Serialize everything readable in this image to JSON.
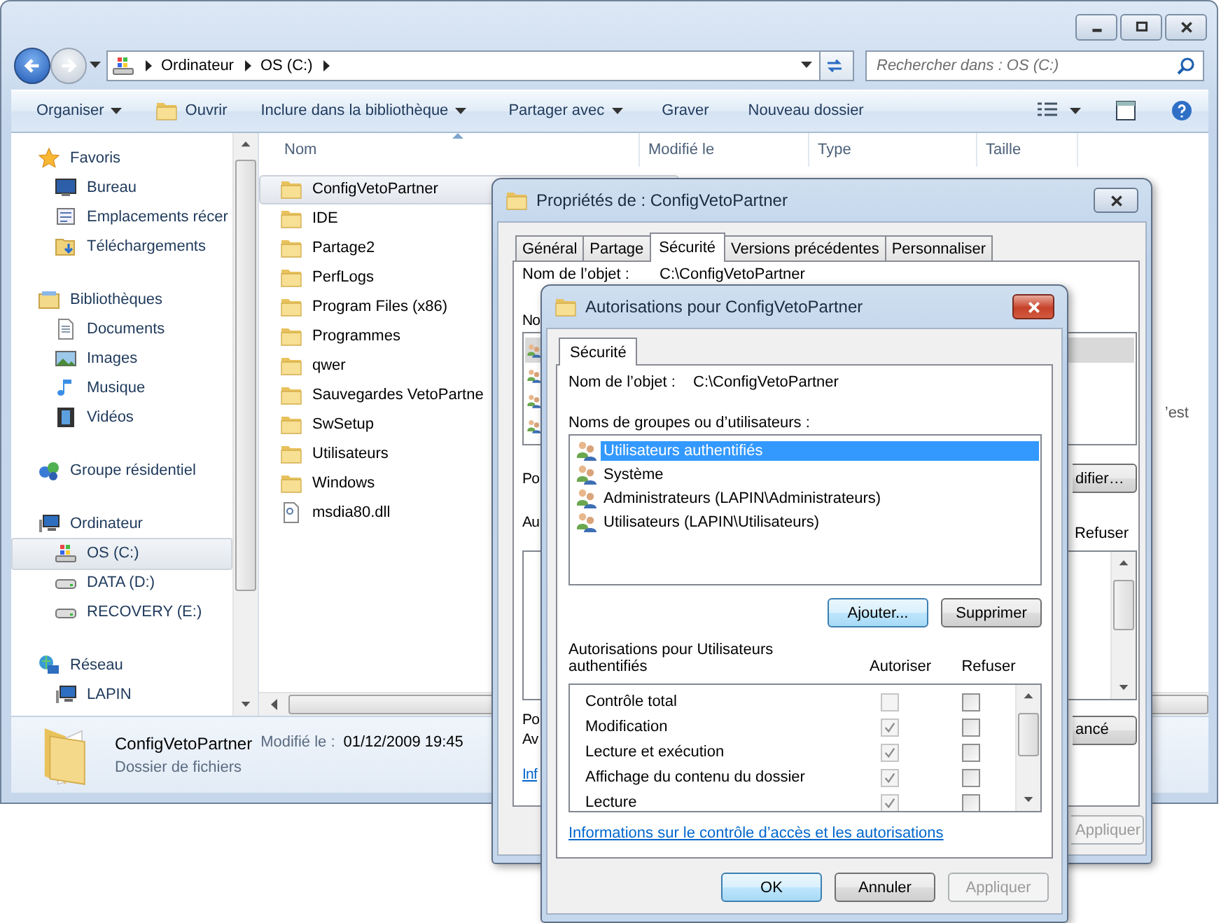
{
  "explorer": {
    "address": {
      "crumbs": [
        "Ordinateur",
        "OS (C:)"
      ]
    },
    "search": {
      "placeholder": "Rechercher dans : OS (C:)"
    },
    "toolbar": [
      {
        "label": "Organiser",
        "has_menu": true,
        "kind": "plain"
      },
      {
        "label": "Ouvrir",
        "has_menu": false,
        "kind": "with_icon"
      },
      {
        "label": "Inclure dans la bibliothèque",
        "has_menu": true,
        "kind": "plain"
      },
      {
        "label": "Partager avec",
        "has_menu": true,
        "kind": "plain"
      },
      {
        "label": "Graver",
        "has_menu": false,
        "kind": "plain"
      },
      {
        "label": "Nouveau dossier",
        "has_menu": false,
        "kind": "plain"
      }
    ],
    "sidebar": [
      {
        "label": "Favoris",
        "kind": "star",
        "children": [
          {
            "label": "Bureau",
            "kind": "desktop",
            "selected": false
          },
          {
            "label": "Emplacements récer",
            "kind": "recent",
            "selected": false
          },
          {
            "label": "Téléchargements",
            "kind": "downloads",
            "selected": false
          }
        ]
      },
      {
        "label": "Bibliothèques",
        "kind": "library",
        "children": [
          {
            "label": "Documents",
            "kind": "document",
            "selected": false
          },
          {
            "label": "Images",
            "kind": "image",
            "selected": false
          },
          {
            "label": "Musique",
            "kind": "music",
            "selected": false
          },
          {
            "label": "Vidéos",
            "kind": "video",
            "selected": false
          }
        ]
      },
      {
        "label": "Groupe résidentiel",
        "kind": "homegroup"
      },
      {
        "label": "Ordinateur",
        "kind": "computer",
        "children": [
          {
            "label": "OS (C:)",
            "kind": "osdrive",
            "selected": true
          },
          {
            "label": "DATA (D:)",
            "kind": "drive",
            "selected": false
          },
          {
            "label": "RECOVERY (E:)",
            "kind": "drive",
            "selected": false
          }
        ]
      },
      {
        "label": "Réseau",
        "kind": "network",
        "children": [
          {
            "label": "LAPIN",
            "kind": "computer",
            "selected": false
          }
        ]
      }
    ],
    "columns": [
      "Nom",
      "Modifié le",
      "Type",
      "Taille"
    ],
    "files": [
      {
        "name": "ConfigVetoPartner",
        "kind": "folder",
        "selected": true
      },
      {
        "name": "IDE",
        "kind": "folder",
        "selected": false
      },
      {
        "name": "Partage2",
        "kind": "folder",
        "selected": false
      },
      {
        "name": "PerfLogs",
        "kind": "folder",
        "selected": false
      },
      {
        "name": "Program Files (x86)",
        "kind": "folder",
        "selected": false
      },
      {
        "name": "Programmes",
        "kind": "folder",
        "selected": false
      },
      {
        "name": "qwer",
        "kind": "folder",
        "selected": false
      },
      {
        "name": "Sauvegardes VetoPartne",
        "kind": "folder",
        "selected": false
      },
      {
        "name": "SwSetup",
        "kind": "folder",
        "selected": false
      },
      {
        "name": "Utilisateurs",
        "kind": "folder",
        "selected": false
      },
      {
        "name": "Windows",
        "kind": "folder",
        "selected": false
      },
      {
        "name": "msdia80.dll",
        "kind": "file",
        "selected": false
      }
    ],
    "side_text": "’est",
    "details": {
      "name": "ConfigVetoPartner",
      "modified_label": "Modifié le :",
      "modified_value": "01/12/2009 19:45",
      "type": "Dossier de fichiers"
    }
  },
  "properties_dialog": {
    "title": "Propriétés de : ConfigVetoPartner",
    "tabs": [
      {
        "label": "Général",
        "selected": false
      },
      {
        "label": "Partage",
        "selected": false
      },
      {
        "label": "Sécurité",
        "selected": true
      },
      {
        "label": "Versions précédentes",
        "selected": false
      },
      {
        "label": "Personnaliser",
        "selected": false
      }
    ],
    "object_label": "Nom de l’objet :",
    "object_value": "C:\\ConfigVetoPartner",
    "groups_label": "No",
    "user_rows": [
      {
        "selected": true
      },
      {
        "selected": false
      },
      {
        "selected": false
      },
      {
        "selected": false
      }
    ],
    "edit_label": "Po",
    "edit_button": "difier…",
    "permissions_label": "Au",
    "deny_header": "Refuser",
    "advanced_label_1": "Po",
    "advanced_label_2": "Av",
    "advanced_button": "ancé",
    "info_link": "Inf",
    "apply_button": {
      "label": "Appliquer",
      "disabled": true
    }
  },
  "permissions_dialog": {
    "title": "Autorisations pour ConfigVetoPartner",
    "tab": "Sécurité",
    "object_label": "Nom de l’objet :",
    "object_value": "C:\\ConfigVetoPartner",
    "groups_label": "Noms de groupes ou d’utilisateurs :",
    "users": [
      {
        "name": "Utilisateurs authentifiés",
        "selected": true
      },
      {
        "name": "Système",
        "selected": false
      },
      {
        "name": "Administrateurs (LAPIN\\Administrateurs)",
        "selected": false
      },
      {
        "name": "Utilisateurs (LAPIN\\Utilisateurs)",
        "selected": false
      }
    ],
    "add_button": "Ajouter...",
    "remove_button": "Supprimer",
    "permissions_title": "Autorisations pour Utilisateurs authentifiés",
    "allow_header": "Autoriser",
    "deny_header": "Refuser",
    "permissions": [
      {
        "name": "Contrôle total",
        "allow": {
          "checked": false,
          "disabled": true
        },
        "deny": {
          "checked": false,
          "disabled": false
        }
      },
      {
        "name": "Modification",
        "allow": {
          "checked": true,
          "disabled": true
        },
        "deny": {
          "checked": false,
          "disabled": false
        }
      },
      {
        "name": "Lecture et exécution",
        "allow": {
          "checked": true,
          "disabled": true
        },
        "deny": {
          "checked": false,
          "disabled": false
        }
      },
      {
        "name": "Affichage du contenu du dossier",
        "allow": {
          "checked": true,
          "disabled": true
        },
        "deny": {
          "checked": false,
          "disabled": false
        }
      },
      {
        "name": "Lecture",
        "allow": {
          "checked": true,
          "disabled": true
        },
        "deny": {
          "checked": false,
          "disabled": false
        }
      }
    ],
    "info_link": "Informations sur le contrôle d’accès et les autorisations",
    "buttons": [
      {
        "label": "OK",
        "disabled": false
      },
      {
        "label": "Annuler",
        "disabled": false
      },
      {
        "label": "Appliquer",
        "disabled": true
      }
    ]
  }
}
